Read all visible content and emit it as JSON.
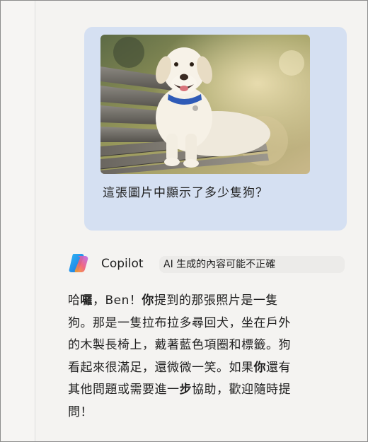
{
  "user_message": {
    "image_alt": "Labrador retriever lying on a wooden bench",
    "text": "這張圖片中顯示了多少隻狗？"
  },
  "assistant": {
    "name": "Copilot",
    "badge": "AI 生成的內容可能不正確",
    "reply_segments": [
      {
        "text": "哈",
        "bold": false
      },
      {
        "text": "囉",
        "bold": true
      },
      {
        "text": "，Ben！",
        "bold": false
      },
      {
        "text": "你",
        "bold": true
      },
      {
        "text": "提到的那張照片是一隻狗。那是一隻拉布拉多尋回犬，坐在戶外的木製長椅上，戴著藍色項圈和標籤。狗看起來很滿足，還微微一笑。如果",
        "bold": false
      },
      {
        "text": "你",
        "bold": true
      },
      {
        "text": "還有其他問題或需要進一",
        "bold": false
      },
      {
        "text": "步",
        "bold": true
      },
      {
        "text": "協助，歡迎隨時提問！",
        "bold": false
      }
    ]
  },
  "colors": {
    "user_bubble": "#d5e0f2",
    "background": "#f4f3f1",
    "badge_bg": "#ecebe9",
    "text": "#1f1f1f",
    "dog_collar": "#2f5bb7"
  },
  "icons": {
    "assistant_logo": "copilot-logo-icon"
  }
}
